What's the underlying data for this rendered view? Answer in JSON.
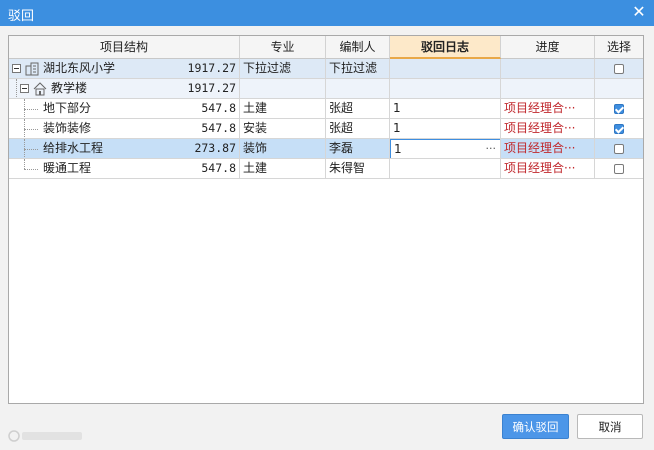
{
  "window": {
    "title": "驳回",
    "close_glyph": "✕"
  },
  "table": {
    "columns": [
      "项目结构",
      "专业",
      "编制人",
      "驳回日志",
      "进度",
      "选择"
    ],
    "active_column": "驳回日志",
    "rows": [
      {
        "name": "湖北东风小学",
        "amount": "1917.27",
        "major": "下拉过滤",
        "editor": "下拉过滤",
        "log": "",
        "progress": "",
        "checked": false,
        "level": 0,
        "icon": "building-icon"
      },
      {
        "name": "教学楼",
        "amount": "1917.27",
        "major": "",
        "editor": "",
        "log": "",
        "progress": "",
        "checked": null,
        "level": 1,
        "icon": "house-icon"
      },
      {
        "name": "地下部分",
        "amount": "547.8",
        "major": "土建",
        "editor": "张超",
        "log": "1",
        "progress": "项目经理合···",
        "checked": true,
        "level": 2
      },
      {
        "name": "装饰装修",
        "amount": "547.8",
        "major": "安装",
        "editor": "张超",
        "log": "1",
        "progress": "项目经理合···",
        "checked": true,
        "level": 2
      },
      {
        "name": "给排水工程",
        "amount": "273.87",
        "major": "装饰",
        "editor": "李磊",
        "log": "1",
        "progress": "项目经理合···",
        "checked": false,
        "level": 2,
        "selected": true
      },
      {
        "name": "暖通工程",
        "amount": "547.8",
        "major": "土建",
        "editor": "朱得智",
        "log": "",
        "progress": "项目经理合···",
        "checked": false,
        "level": 2
      }
    ]
  },
  "buttons": {
    "confirm": "确认驳回",
    "cancel": "取消"
  },
  "colors": {
    "titlebar": "#3c8fe0",
    "accent": "#3e8ee0",
    "progress_text": "#c0282d",
    "selected_row": "#c6dff7"
  }
}
